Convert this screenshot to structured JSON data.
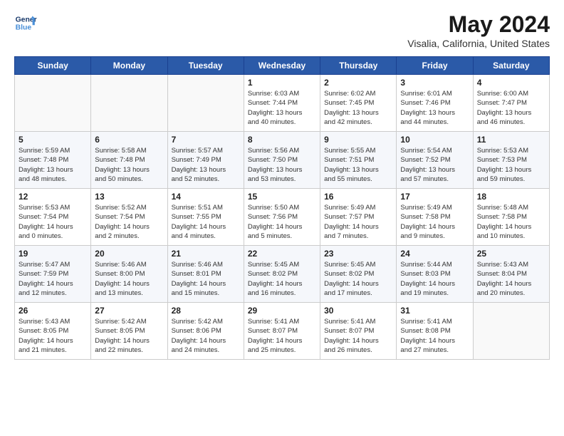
{
  "header": {
    "logo_line1": "General",
    "logo_line2": "Blue",
    "month_year": "May 2024",
    "location": "Visalia, California, United States"
  },
  "weekdays": [
    "Sunday",
    "Monday",
    "Tuesday",
    "Wednesday",
    "Thursday",
    "Friday",
    "Saturday"
  ],
  "weeks": [
    [
      {
        "day": "",
        "info": ""
      },
      {
        "day": "",
        "info": ""
      },
      {
        "day": "",
        "info": ""
      },
      {
        "day": "1",
        "info": "Sunrise: 6:03 AM\nSunset: 7:44 PM\nDaylight: 13 hours\nand 40 minutes."
      },
      {
        "day": "2",
        "info": "Sunrise: 6:02 AM\nSunset: 7:45 PM\nDaylight: 13 hours\nand 42 minutes."
      },
      {
        "day": "3",
        "info": "Sunrise: 6:01 AM\nSunset: 7:46 PM\nDaylight: 13 hours\nand 44 minutes."
      },
      {
        "day": "4",
        "info": "Sunrise: 6:00 AM\nSunset: 7:47 PM\nDaylight: 13 hours\nand 46 minutes."
      }
    ],
    [
      {
        "day": "5",
        "info": "Sunrise: 5:59 AM\nSunset: 7:48 PM\nDaylight: 13 hours\nand 48 minutes."
      },
      {
        "day": "6",
        "info": "Sunrise: 5:58 AM\nSunset: 7:48 PM\nDaylight: 13 hours\nand 50 minutes."
      },
      {
        "day": "7",
        "info": "Sunrise: 5:57 AM\nSunset: 7:49 PM\nDaylight: 13 hours\nand 52 minutes."
      },
      {
        "day": "8",
        "info": "Sunrise: 5:56 AM\nSunset: 7:50 PM\nDaylight: 13 hours\nand 53 minutes."
      },
      {
        "day": "9",
        "info": "Sunrise: 5:55 AM\nSunset: 7:51 PM\nDaylight: 13 hours\nand 55 minutes."
      },
      {
        "day": "10",
        "info": "Sunrise: 5:54 AM\nSunset: 7:52 PM\nDaylight: 13 hours\nand 57 minutes."
      },
      {
        "day": "11",
        "info": "Sunrise: 5:53 AM\nSunset: 7:53 PM\nDaylight: 13 hours\nand 59 minutes."
      }
    ],
    [
      {
        "day": "12",
        "info": "Sunrise: 5:53 AM\nSunset: 7:54 PM\nDaylight: 14 hours\nand 0 minutes."
      },
      {
        "day": "13",
        "info": "Sunrise: 5:52 AM\nSunset: 7:54 PM\nDaylight: 14 hours\nand 2 minutes."
      },
      {
        "day": "14",
        "info": "Sunrise: 5:51 AM\nSunset: 7:55 PM\nDaylight: 14 hours\nand 4 minutes."
      },
      {
        "day": "15",
        "info": "Sunrise: 5:50 AM\nSunset: 7:56 PM\nDaylight: 14 hours\nand 5 minutes."
      },
      {
        "day": "16",
        "info": "Sunrise: 5:49 AM\nSunset: 7:57 PM\nDaylight: 14 hours\nand 7 minutes."
      },
      {
        "day": "17",
        "info": "Sunrise: 5:49 AM\nSunset: 7:58 PM\nDaylight: 14 hours\nand 9 minutes."
      },
      {
        "day": "18",
        "info": "Sunrise: 5:48 AM\nSunset: 7:58 PM\nDaylight: 14 hours\nand 10 minutes."
      }
    ],
    [
      {
        "day": "19",
        "info": "Sunrise: 5:47 AM\nSunset: 7:59 PM\nDaylight: 14 hours\nand 12 minutes."
      },
      {
        "day": "20",
        "info": "Sunrise: 5:46 AM\nSunset: 8:00 PM\nDaylight: 14 hours\nand 13 minutes."
      },
      {
        "day": "21",
        "info": "Sunrise: 5:46 AM\nSunset: 8:01 PM\nDaylight: 14 hours\nand 15 minutes."
      },
      {
        "day": "22",
        "info": "Sunrise: 5:45 AM\nSunset: 8:02 PM\nDaylight: 14 hours\nand 16 minutes."
      },
      {
        "day": "23",
        "info": "Sunrise: 5:45 AM\nSunset: 8:02 PM\nDaylight: 14 hours\nand 17 minutes."
      },
      {
        "day": "24",
        "info": "Sunrise: 5:44 AM\nSunset: 8:03 PM\nDaylight: 14 hours\nand 19 minutes."
      },
      {
        "day": "25",
        "info": "Sunrise: 5:43 AM\nSunset: 8:04 PM\nDaylight: 14 hours\nand 20 minutes."
      }
    ],
    [
      {
        "day": "26",
        "info": "Sunrise: 5:43 AM\nSunset: 8:05 PM\nDaylight: 14 hours\nand 21 minutes."
      },
      {
        "day": "27",
        "info": "Sunrise: 5:42 AM\nSunset: 8:05 PM\nDaylight: 14 hours\nand 22 minutes."
      },
      {
        "day": "28",
        "info": "Sunrise: 5:42 AM\nSunset: 8:06 PM\nDaylight: 14 hours\nand 24 minutes."
      },
      {
        "day": "29",
        "info": "Sunrise: 5:41 AM\nSunset: 8:07 PM\nDaylight: 14 hours\nand 25 minutes."
      },
      {
        "day": "30",
        "info": "Sunrise: 5:41 AM\nSunset: 8:07 PM\nDaylight: 14 hours\nand 26 minutes."
      },
      {
        "day": "31",
        "info": "Sunrise: 5:41 AM\nSunset: 8:08 PM\nDaylight: 14 hours\nand 27 minutes."
      },
      {
        "day": "",
        "info": ""
      }
    ]
  ]
}
